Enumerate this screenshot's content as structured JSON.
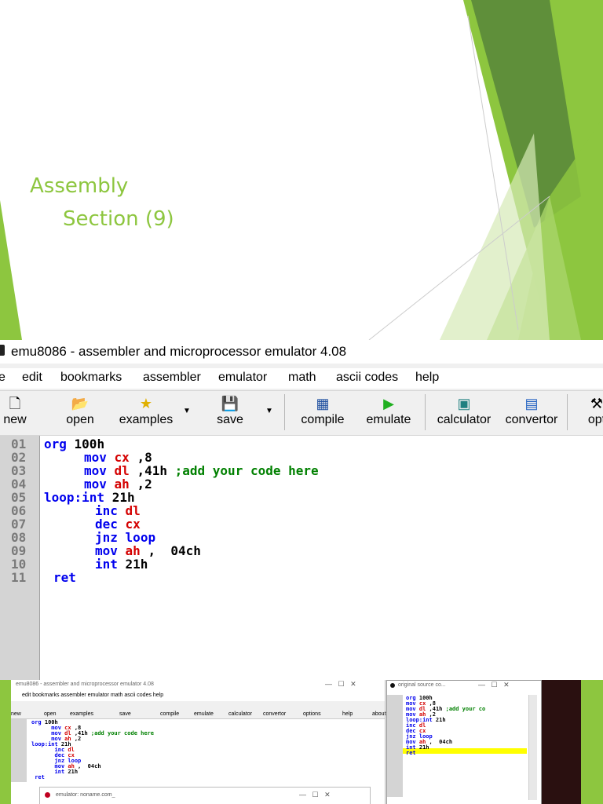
{
  "slide": {
    "title": "Assembly",
    "subtitle": "Section (9)"
  },
  "window": {
    "title": "emu8086 - assembler and microprocessor emulator 4.08",
    "menu": [
      "e",
      "edit",
      "bookmarks",
      "assembler",
      "emulator",
      "math",
      "ascii codes",
      "help"
    ],
    "toolbar": [
      {
        "label": "new",
        "icon": "new-file-icon"
      },
      {
        "label": "open",
        "icon": "open-folder-icon"
      },
      {
        "label": "examples",
        "icon": "star-icon"
      },
      {
        "label": "save",
        "icon": "floppy-icon"
      },
      {
        "label": "compile",
        "icon": "compile-icon"
      },
      {
        "label": "emulate",
        "icon": "play-icon"
      },
      {
        "label": "calculator",
        "icon": "calculator-icon"
      },
      {
        "label": "convertor",
        "icon": "convertor-icon"
      },
      {
        "label": "opt",
        "icon": "tools-icon"
      }
    ],
    "line_numbers": [
      "01",
      "02",
      "03",
      "04",
      "05",
      "06",
      "07",
      "08",
      "09",
      "10",
      "11"
    ],
    "code": {
      "l1": {
        "a": "org",
        "b": " 100h"
      },
      "l2": {
        "a": "mov",
        "r": "cx",
        "b": " ,8"
      },
      "l3": {
        "a": "mov",
        "r": "dl",
        "b": " ,41h",
        "c": ";add your code here"
      },
      "l4": {
        "a": "mov",
        "r": "ah",
        "b": " ,2"
      },
      "l5": {
        "a": "loop:int",
        "b": " 21h"
      },
      "l6": {
        "a": "inc",
        "r": "dl"
      },
      "l7": {
        "a": "dec",
        "r": "cx"
      },
      "l8": {
        "a": "jnz",
        "k2": "loop"
      },
      "l9": {
        "a": "mov",
        "r": "ah",
        "b": " ,  04ch"
      },
      "l10": {
        "a": "int",
        "b": " 21h"
      },
      "l11": {
        "a": "ret"
      }
    }
  },
  "small": {
    "main_title": "emu8086 - assembler and microprocessor emulator 4.08",
    "main_menu": "edit   bookmarks   assembler   emulator   math   ascii codes   help",
    "main_toolbar": [
      "new",
      "open",
      "examples",
      "save",
      "compile",
      "emulate",
      "calculator",
      "convertor",
      "options",
      "help",
      "about"
    ],
    "src_title": "original source co...",
    "src_lines": [
      "01",
      "02",
      "03",
      "04",
      "05",
      "06",
      "07",
      "08",
      "09",
      "10",
      "11",
      "12",
      "13"
    ],
    "emulator_title": "emulator: noname.com_"
  },
  "colors": {
    "accent_green": "#8dc63f",
    "dark_green": "#6a9a3a",
    "keyword_blue": "#0000ee",
    "register_red": "#d40000",
    "comment_green": "#008000",
    "highlight_yellow": "#ffff00"
  }
}
